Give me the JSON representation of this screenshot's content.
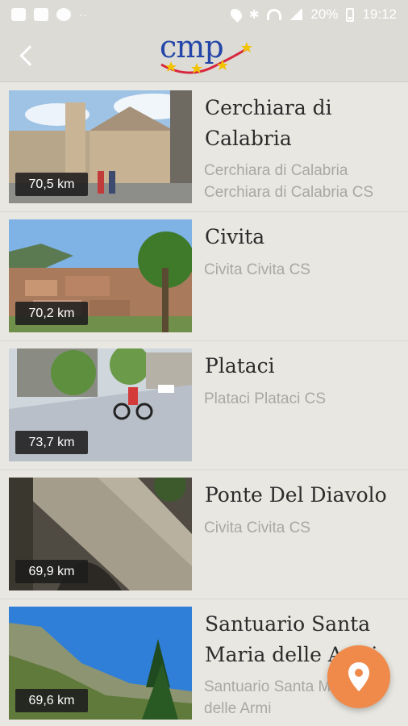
{
  "status_bar": {
    "battery": "20%",
    "time": "19:12",
    "left_icons": [
      "gallery-icon",
      "mail-icon",
      "whatsapp-icon"
    ],
    "right_icons": [
      "location-icon",
      "bluetooth-icon",
      "wifi-icon",
      "signal-icon",
      "battery-icon"
    ]
  },
  "app_bar": {
    "logo_text": "cmp",
    "back_icon": "chevron-left-icon"
  },
  "colors": {
    "background": "#e9e7e1",
    "bar": "#dcdbd6",
    "fab": "#ef8a4b",
    "logo_blue": "#2446a8",
    "logo_red": "#d7263d",
    "logo_yellow": "#f2c300"
  },
  "places": [
    {
      "distance": "70,5 km",
      "title_lines": [
        "Cerchiara di",
        "Calabria"
      ],
      "subtitle_lines": [
        "Cerchiara di Calabria",
        "Cerchiara di Calabria CS"
      ]
    },
    {
      "distance": "70,2 km",
      "title_lines": [
        "Civita"
      ],
      "subtitle_lines": [
        "Civita Civita CS"
      ]
    },
    {
      "distance": "73,7 km",
      "title_lines": [
        "Plataci"
      ],
      "subtitle_lines": [
        "Plataci Plataci CS"
      ]
    },
    {
      "distance": "69,9 km",
      "title_lines": [
        "Ponte Del Diavolo"
      ],
      "subtitle_lines": [
        "Civita Civita CS"
      ]
    },
    {
      "distance": "69,6 km",
      "title_lines": [
        "Santuario Santa",
        "Maria delle Armi"
      ],
      "subtitle_lines": [
        "Santuario Santa Maria",
        "delle Armi"
      ]
    }
  ],
  "fab": {
    "icon": "map-pin-icon"
  }
}
